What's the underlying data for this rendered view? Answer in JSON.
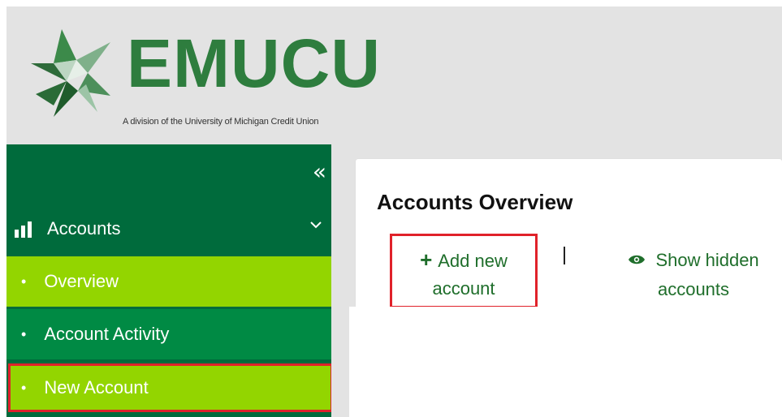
{
  "header": {
    "logo_text": "EMUCU",
    "tagline": "A division of the University of Michigan Credit Union"
  },
  "sidebar": {
    "collapse_icon": "double-chevron-left-icon",
    "section": {
      "label": "Accounts",
      "icon": "bar-chart-icon",
      "expand_icon": "chevron-down-icon"
    },
    "items": [
      {
        "label": "Overview",
        "active": true
      },
      {
        "label": "Account Activity",
        "active": false
      },
      {
        "label": "New Account",
        "active": true,
        "highlighted": true
      }
    ]
  },
  "main": {
    "title": "Accounts Overview",
    "actions": {
      "add": {
        "line1": "Add new",
        "line2": "account",
        "icon": "plus-icon"
      },
      "separator": "|",
      "show_hidden": {
        "line1": "Show hidden",
        "line2": "accounts",
        "icon": "eye-icon"
      }
    }
  },
  "colors": {
    "sidebar_bg": "#006b3c",
    "active_item_bg": "#93d500",
    "item_bg": "#008a44",
    "brand_green": "#2e7d3e",
    "highlight_border": "#e0222a"
  }
}
